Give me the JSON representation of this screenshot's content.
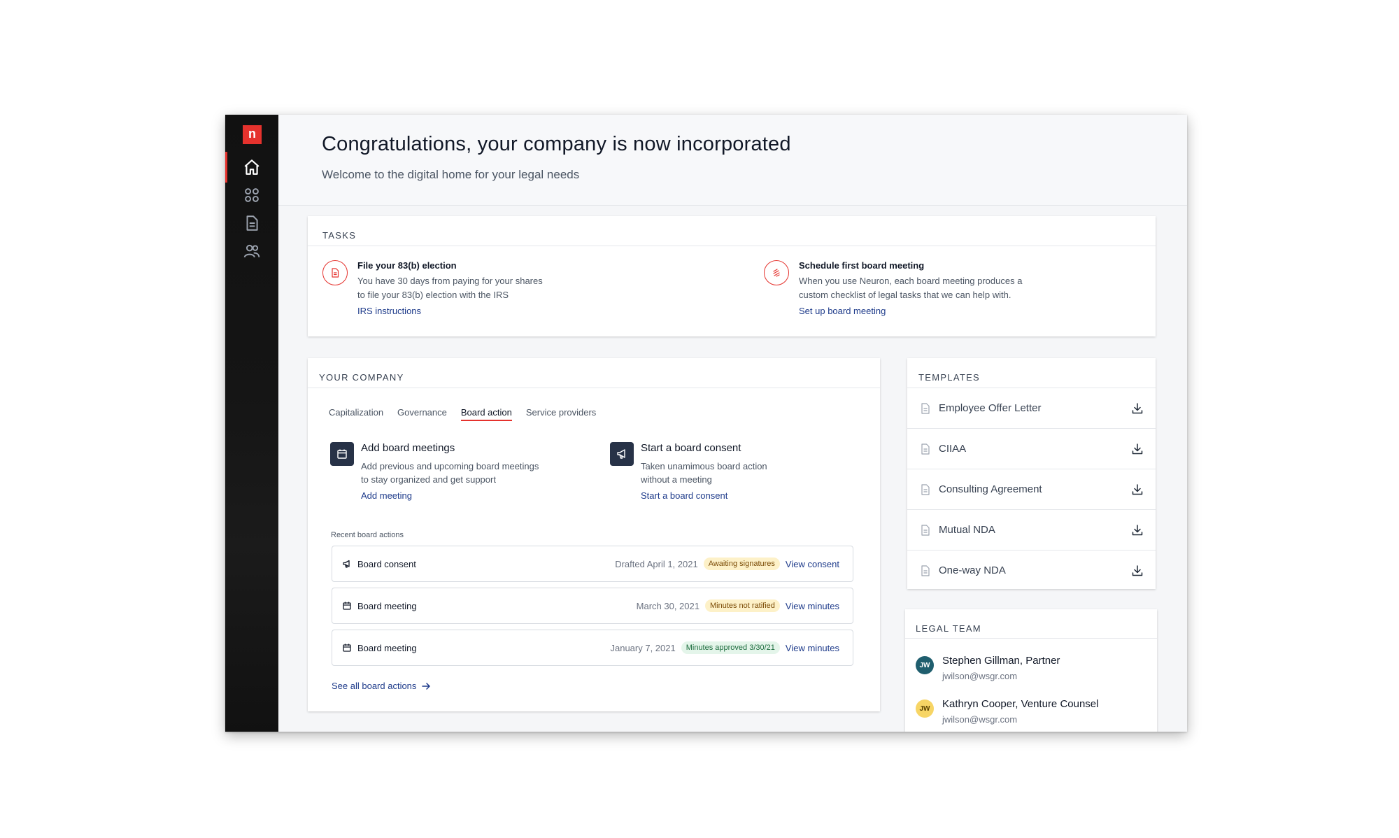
{
  "sidebar": {
    "logo": "n",
    "nav": [
      "home-icon",
      "apps-icon",
      "document-icon",
      "people-icon"
    ]
  },
  "header": {
    "title": "Congratulations, your company is now incorporated",
    "subtitle": "Welcome to the digital home for your legal needs"
  },
  "tasks": {
    "title": "TASKS",
    "items": [
      {
        "icon": "document-icon",
        "title": "File your 83(b) election",
        "desc1": "You have 30 days from paying for your shares",
        "desc2": "to file your 83(b) election with the IRS",
        "link": "IRS instructions"
      },
      {
        "icon": "gavel-icon",
        "title": "Schedule first board meeting",
        "desc1": "When you use Neuron, each board meeting produces a",
        "desc2": "custom checklist of legal tasks that we can help with.",
        "link": "Set up board meeting"
      }
    ]
  },
  "company": {
    "title": "YOUR COMPANY",
    "tabs": [
      "Capitalization",
      "Governance",
      "Board action",
      "Service providers"
    ],
    "active_tab": "Board action",
    "actions": [
      {
        "icon": "calendar-icon",
        "title": "Add board meetings",
        "desc1": "Add previous and upcoming board meetings",
        "desc2": "to stay organized and get support",
        "link": "Add meeting"
      },
      {
        "icon": "megaphone-icon",
        "title": "Start a board consent",
        "desc1": "Taken unamimous board action",
        "desc2": "without a meeting",
        "link": "Start a board consent"
      }
    ],
    "recent_label": "Recent board actions",
    "recent": [
      {
        "icon": "megaphone-icon",
        "label": "Board consent",
        "date": "Drafted April 1, 2021",
        "status": "Awaiting signatures",
        "status_color": "#fdf1c8",
        "link": "View consent"
      },
      {
        "icon": "calendar-icon",
        "label": "Board meeting",
        "date": "March 30, 2021",
        "status": "Minutes not ratified",
        "status_color": "#fdf1c8",
        "link": "View minutes"
      },
      {
        "icon": "calendar-icon",
        "label": "Board meeting",
        "date": "January 7, 2021",
        "status": "Minutes approved 3/30/21",
        "status_color": "#e4f5ea",
        "link": "View minutes"
      }
    ],
    "see_all": "See all board actions"
  },
  "templates": {
    "title": "TEMPLATES",
    "items": [
      "Employee Offer Letter",
      "CIIAA",
      "Consulting Agreement",
      "Mutual NDA",
      "One-way NDA"
    ]
  },
  "legal_team": {
    "title": "LEGAL TEAM",
    "members": [
      {
        "initials": "JW",
        "name": "Stephen Gillman, Partner",
        "email": "jwilson@wsgr.com",
        "avatar_color": "#1f5e6e"
      },
      {
        "initials": "JW",
        "name": "Kathryn Cooper, Venture Counsel",
        "email": "jwilson@wsgr.com",
        "avatar_color": "#f7d565"
      }
    ]
  },
  "colors": {
    "accent": "#e5322d",
    "link": "#1d3a8a",
    "sidebar": "#151515"
  }
}
